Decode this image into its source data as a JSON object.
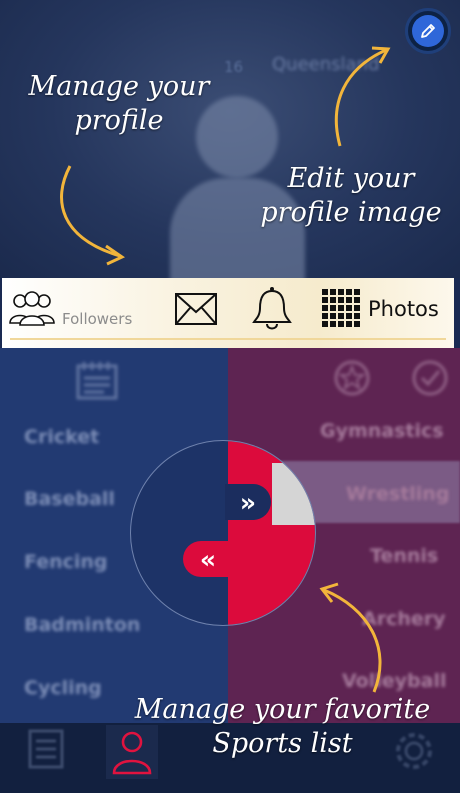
{
  "header": {
    "background_number": "16",
    "background_team": "Queensland"
  },
  "hints": {
    "manage_profile": "Manage your profile",
    "edit_image": "Edit your profile image",
    "manage_sports": "Manage your favorite Sports list"
  },
  "tabs": {
    "followers": "Followers",
    "messages_icon": "envelope-icon",
    "notifications_icon": "bell-icon",
    "photos": "Photos"
  },
  "sports_left": [
    "Cricket",
    "Baseball",
    "Fencing",
    "Badminton",
    "Cycling"
  ],
  "sports_right": [
    "Gymnastics",
    "Wrestling",
    "Tennis",
    "Archery",
    "Volleyball"
  ],
  "toggle": {
    "forward_symbol": "»",
    "back_symbol": "«"
  },
  "bottom_nav": {
    "list_icon": "list-icon",
    "profile_icon": "profile-icon",
    "settings_icon": "gear-icon"
  },
  "colors": {
    "header_bg": "#25365d",
    "left_panel": "#223a72",
    "right_panel": "#5e2452",
    "accent_red": "#dc0b3c",
    "edit_button": "#2f67d9",
    "arrow": "#f2b53b"
  }
}
